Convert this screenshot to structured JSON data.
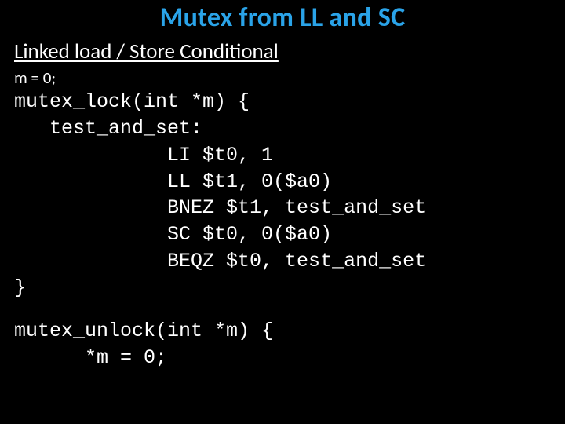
{
  "title": "Mutex from LL and SC",
  "subtitle": "Linked load / Store Conditional",
  "init_line": "m = 0;",
  "lock": {
    "sig": "mutex_lock(int *m) {",
    "label": "   test_and_set:",
    "i1": "             LI $t0, 1",
    "i2": "             LL $t1, 0($a0)",
    "i3": "             BNEZ $t1, test_and_set",
    "i4": "             SC $t0, 0($a0)",
    "i5": "             BEQZ $t0, test_and_set",
    "close": "}"
  },
  "unlock": {
    "sig": "mutex_unlock(int *m) {",
    "body": "      *m = 0;"
  }
}
